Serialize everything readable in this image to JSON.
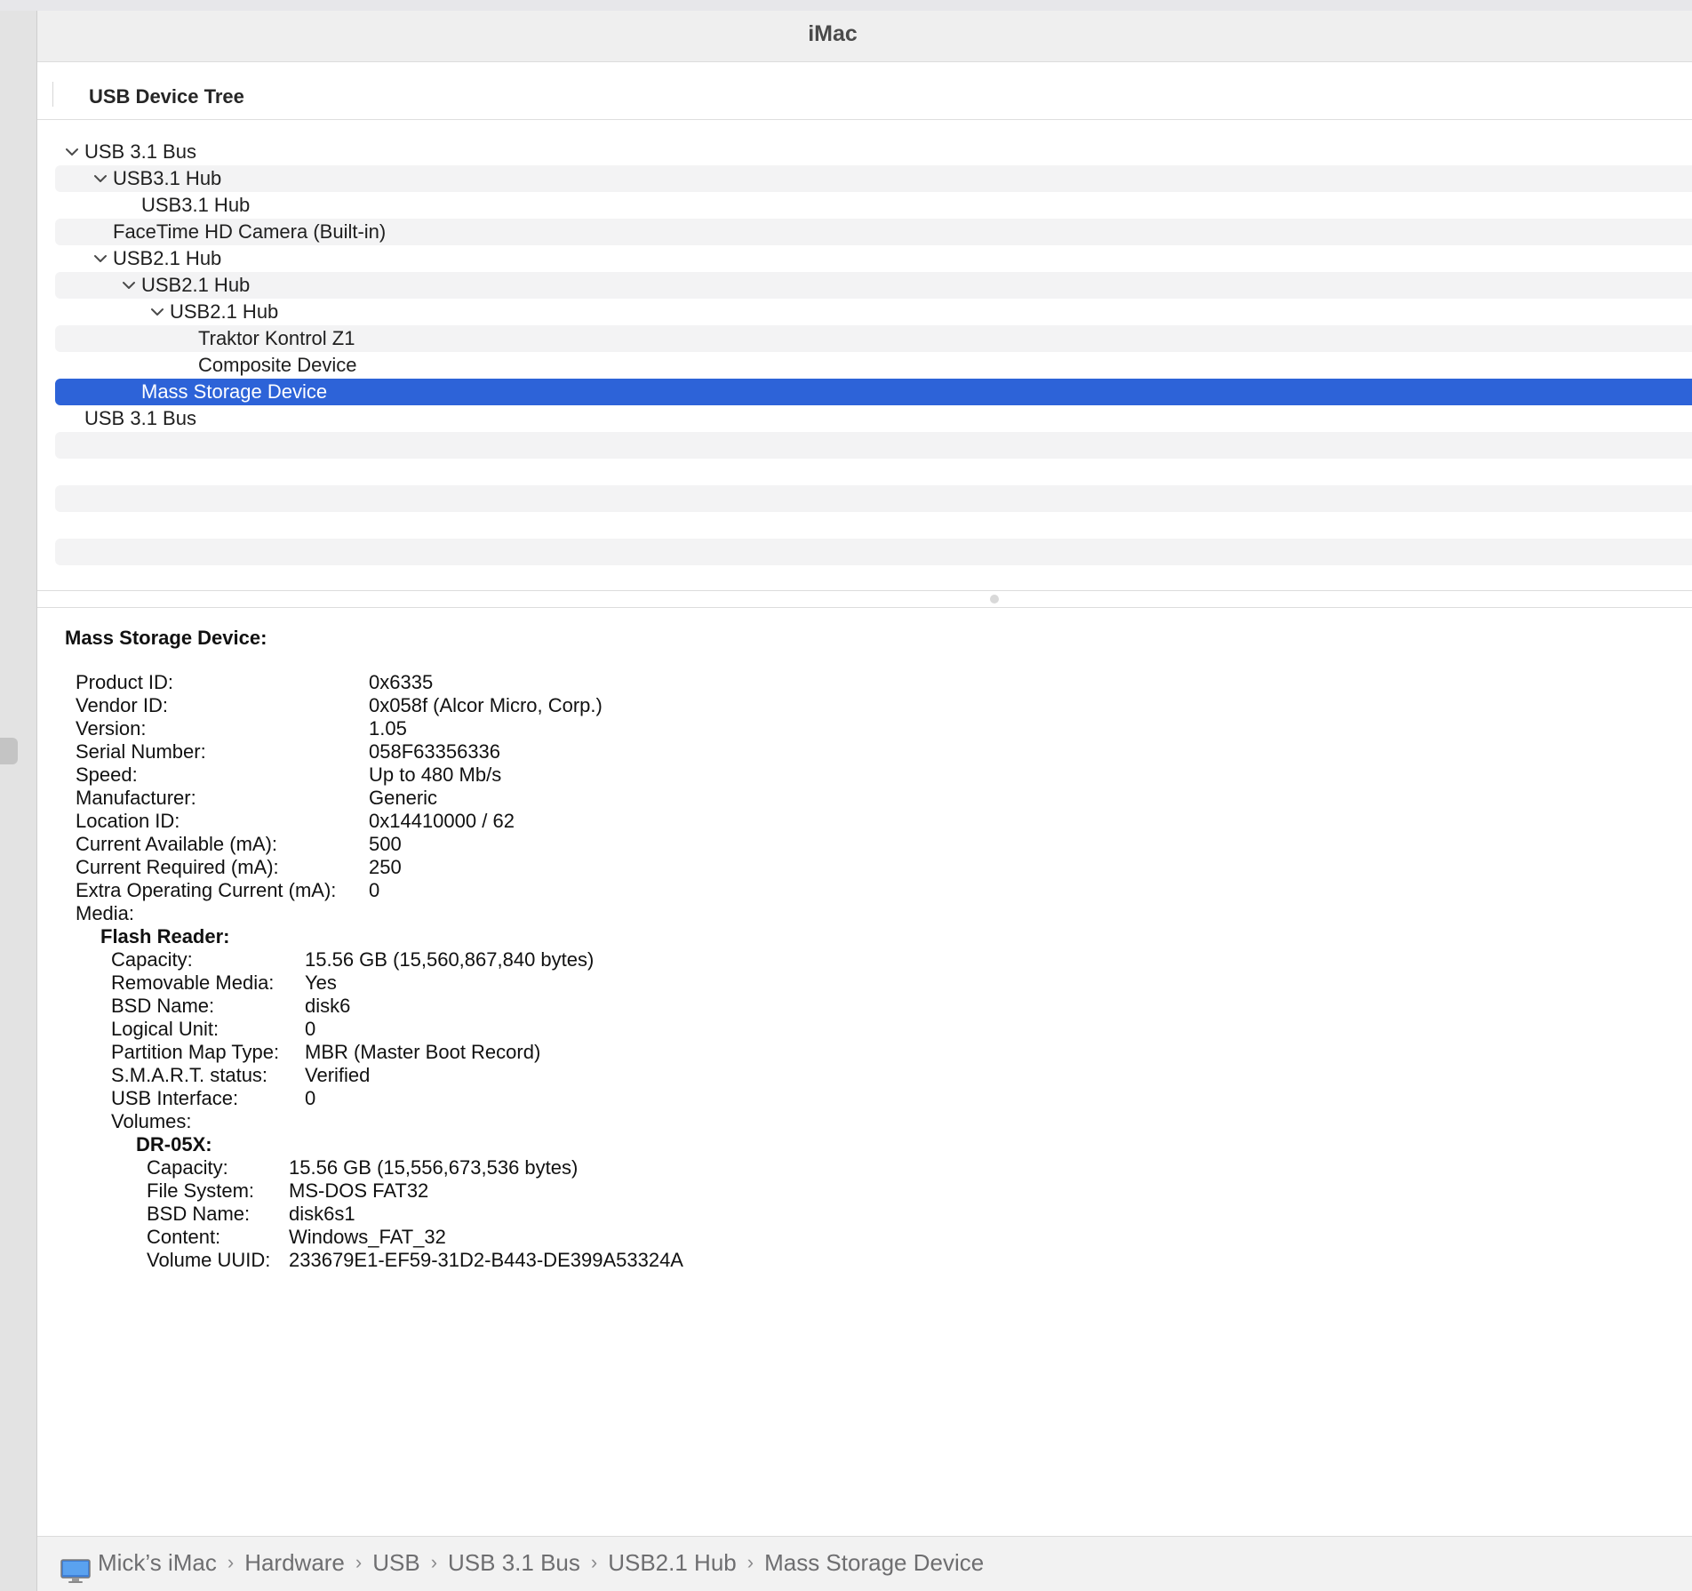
{
  "window": {
    "title": "iMac"
  },
  "tree_header": {
    "label": "USB Device Tree"
  },
  "tree": {
    "items": [
      {
        "label": "USB 3.1 Bus",
        "level": 0,
        "expanded": true
      },
      {
        "label": "USB3.1 Hub",
        "level": 1,
        "expanded": true
      },
      {
        "label": "USB3.1 Hub",
        "level": 2,
        "expanded": null
      },
      {
        "label": "FaceTime HD Camera (Built-in)",
        "level": 1,
        "expanded": null
      },
      {
        "label": "USB2.1 Hub",
        "level": 1,
        "expanded": true
      },
      {
        "label": "USB2.1 Hub",
        "level": 2,
        "expanded": true
      },
      {
        "label": "USB2.1 Hub",
        "level": 3,
        "expanded": true
      },
      {
        "label": "Traktor Kontrol Z1",
        "level": 4,
        "expanded": null
      },
      {
        "label": "Composite Device",
        "level": 4,
        "expanded": null
      },
      {
        "label": "Mass Storage Device",
        "level": 2,
        "expanded": null,
        "selected": true
      },
      {
        "label": "USB 3.1 Bus",
        "level": 0,
        "expanded": null
      }
    ],
    "empty_rows": 6
  },
  "details": {
    "title": "Mass Storage Device:",
    "props": [
      {
        "k": "Product ID:",
        "v": "0x6335"
      },
      {
        "k": "Vendor ID:",
        "v": "0x058f  (Alcor Micro, Corp.)"
      },
      {
        "k": "Version:",
        "v": "1.05"
      },
      {
        "k": "Serial Number:",
        "v": "058F63356336"
      },
      {
        "k": "Speed:",
        "v": "Up to 480 Mb/s"
      },
      {
        "k": "Manufacturer:",
        "v": "Generic"
      },
      {
        "k": "Location ID:",
        "v": "0x14410000 / 62"
      },
      {
        "k": "Current Available (mA):",
        "v": "500"
      },
      {
        "k": "Current Required (mA):",
        "v": "250"
      },
      {
        "k": "Extra Operating Current (mA):",
        "v": "0"
      },
      {
        "k": "Media:",
        "v": ""
      }
    ],
    "media": {
      "title": "Flash Reader:",
      "props": [
        {
          "k": "Capacity:",
          "v": "15.56 GB (15,560,867,840 bytes)"
        },
        {
          "k": "Removable Media:",
          "v": "Yes"
        },
        {
          "k": "BSD Name:",
          "v": "disk6"
        },
        {
          "k": "Logical Unit:",
          "v": "0"
        },
        {
          "k": "Partition Map Type:",
          "v": "MBR (Master Boot Record)"
        },
        {
          "k": "S.M.A.R.T. status:",
          "v": "Verified"
        },
        {
          "k": "USB Interface:",
          "v": "0"
        },
        {
          "k": "Volumes:",
          "v": ""
        }
      ],
      "volume": {
        "title": "DR-05X:",
        "props": [
          {
            "k": "Capacity:",
            "v": "15.56 GB (15,556,673,536 bytes)"
          },
          {
            "k": "File System:",
            "v": "MS-DOS FAT32"
          },
          {
            "k": "BSD Name:",
            "v": "disk6s1"
          },
          {
            "k": "Content:",
            "v": "Windows_FAT_32"
          },
          {
            "k": "Volume UUID:",
            "v": "233679E1-EF59-31D2-B443-DE399A53324A"
          }
        ]
      }
    }
  },
  "breadcrumb": {
    "icon": "imac-icon",
    "items": [
      "Mick’s iMac",
      "Hardware",
      "USB",
      "USB 3.1 Bus",
      "USB2.1 Hub",
      "Mass Storage Device"
    ],
    "separator": "›"
  },
  "colors": {
    "selection": "#2d63d8",
    "alt_row": "#f3f3f4",
    "title_text": "#4a4a4a"
  }
}
